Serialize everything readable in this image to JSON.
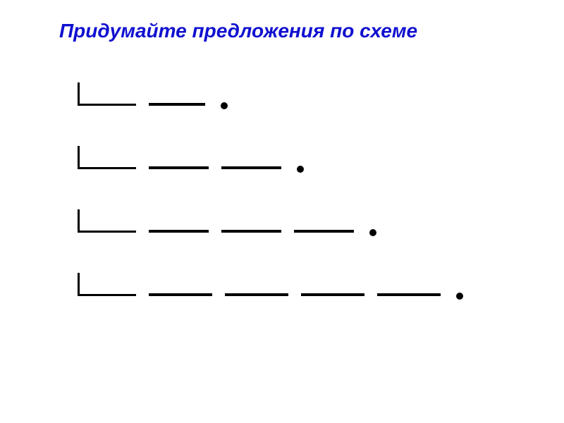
{
  "title": "Придумайте предложения по схеме",
  "schemas": [
    {
      "word_count": 2
    },
    {
      "word_count": 3
    },
    {
      "word_count": 4
    },
    {
      "word_count": 5
    }
  ]
}
